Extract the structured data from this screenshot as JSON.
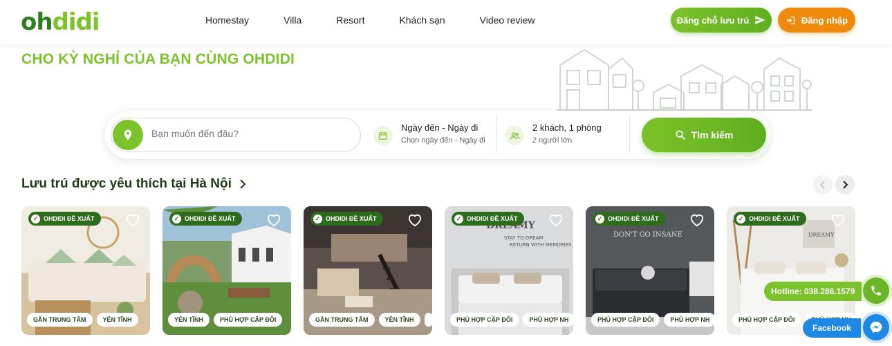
{
  "header": {
    "logo_oh": "oh",
    "logo_didi": "didi",
    "nav": [
      "Homestay",
      "Villa",
      "Resort",
      "Khách sạn",
      "Video review"
    ],
    "book_label": "Đăng chỗ lưu trú",
    "login_label": "Đăng nhập"
  },
  "hero": {
    "title": "CHO KỲ NGHỈ CỦA BẠN CÙNG OHDIDI"
  },
  "search": {
    "location_placeholder": "Bạn muốn đến đâu?",
    "date_title": "Ngày đến - Ngày đi",
    "date_sub": "Chọn ngày đến - Ngày đi",
    "guest_title": "2 khách, 1 phòng",
    "guest_sub": "2 người lớn",
    "button_label": "Tìm kiếm"
  },
  "section": {
    "title": "Lưu trú được yêu thích tại Hà Nội"
  },
  "cards": [
    {
      "badge": "OHDIDI ĐỀ XUẤT",
      "tags": [
        "GẦN TRUNG TÂM",
        "YÊN TĨNH"
      ]
    },
    {
      "badge": "OHDIDI ĐỀ XUẤT",
      "tags": [
        "YÊN TĨNH",
        "PHÙ HỢP CẶP ĐÔI"
      ]
    },
    {
      "badge": "OHDIDI ĐỀ XUẤT",
      "tags": [
        "GẦN TRUNG TÂM",
        "YÊN TĨNH"
      ]
    },
    {
      "badge": "OHDIDI ĐỀ XUẤT",
      "tags": [
        "PHÙ HỢP CẶP ĐÔI",
        "PHÙ HỢP NH"
      ]
    },
    {
      "badge": "OHDIDI ĐỀ XUẤT",
      "tags": [
        "PHÙ HỢP CẶP ĐÔI",
        "PHÙ HỢP NH"
      ]
    },
    {
      "badge": "OHDIDI ĐỀ XUẤT",
      "tags": [
        "PHÙ HỢP CẶP ĐÔI",
        "PHÙ HỢP NH"
      ]
    }
  ],
  "floating": {
    "hotline": "Hotline: 038.286.1579",
    "facebook": "Facebook"
  },
  "colors": {
    "brand_green": "#7cc22a",
    "dark_green": "#2e7d1e",
    "orange": "#f08a0a",
    "facebook_blue": "#1e88e5"
  }
}
